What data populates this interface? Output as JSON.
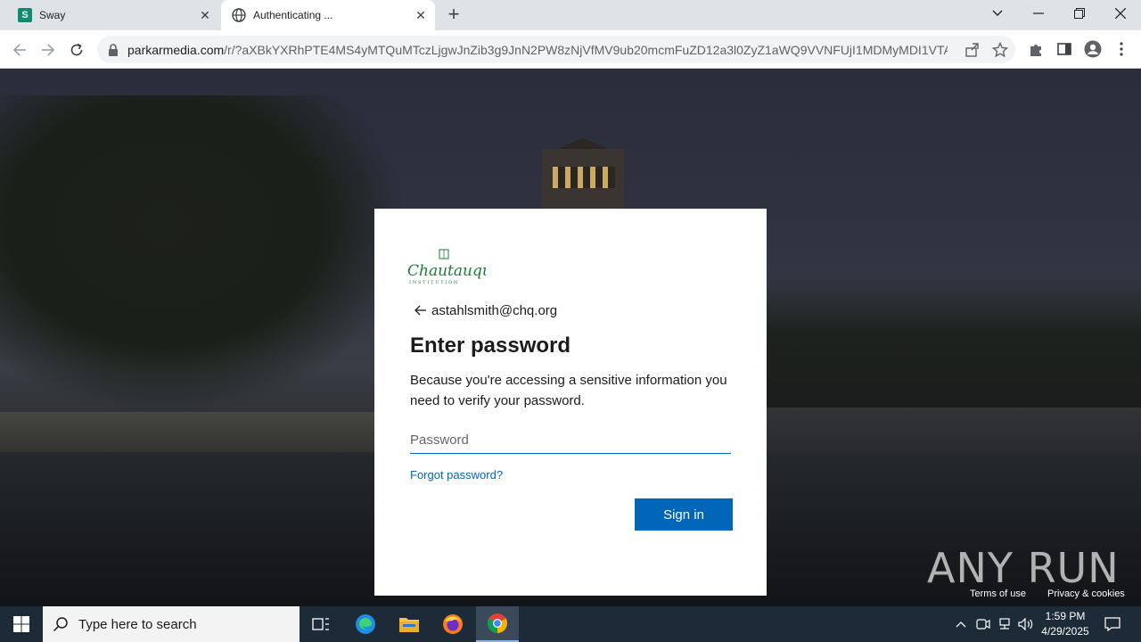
{
  "browser": {
    "tabs": [
      {
        "title": "Sway",
        "active": false
      },
      {
        "title": "Authenticating ...",
        "active": true
      }
    ],
    "new_tab_label": "+",
    "url": {
      "host": "parkarmedia.com",
      "path": "/r/?aXBkYXRhPTE4MS4yMTQuMTczLjgwJnZib3g9JnN2PW8zNjVfMV9ub20mcmFuZD12a3l0ZyZ1aWQ9VVNFUjI1MDMyMDI1VTAyM..."
    }
  },
  "login": {
    "logo_text": "Chautauqua",
    "logo_subtext": "INSTITUTION",
    "email": "astahlsmith@chq.org",
    "heading": "Enter password",
    "description": "Because you're accessing a sensitive information you need to verify your password.",
    "password_placeholder": "Password",
    "forgot_label": "Forgot password?",
    "signin_label": "Sign in"
  },
  "footer": {
    "terms": "Terms of use",
    "privacy": "Privacy & cookies",
    "watermark": "ANY RUN"
  },
  "taskbar": {
    "search_placeholder": "Type here to search",
    "time": "1:59 PM",
    "date": "4/29/2025"
  },
  "colors": {
    "accent": "#0067b8",
    "taskbar": "#1d2a38"
  }
}
